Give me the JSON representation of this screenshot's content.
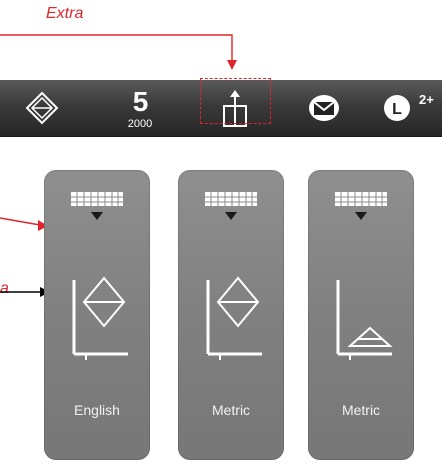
{
  "annotations": {
    "extra_label": "Extra",
    "side_label_partial": "a"
  },
  "toolbar": {
    "count_big": "5",
    "count_small": "2000",
    "superscript": "2+",
    "icons": [
      "diamond-icon",
      "number-counter",
      "split-panel-icon",
      "mail-icon",
      "letter-l-icon"
    ]
  },
  "cards": [
    {
      "label": "English",
      "icon": "diamond-graph-icon"
    },
    {
      "label": "Metric",
      "icon": "diamond-graph-icon"
    },
    {
      "label": "Metric",
      "icon": "triangle-graph-icon"
    }
  ],
  "colors": {
    "annotation": "#e0242b",
    "toolbar": "#3a3a3a",
    "card": "#858585"
  }
}
